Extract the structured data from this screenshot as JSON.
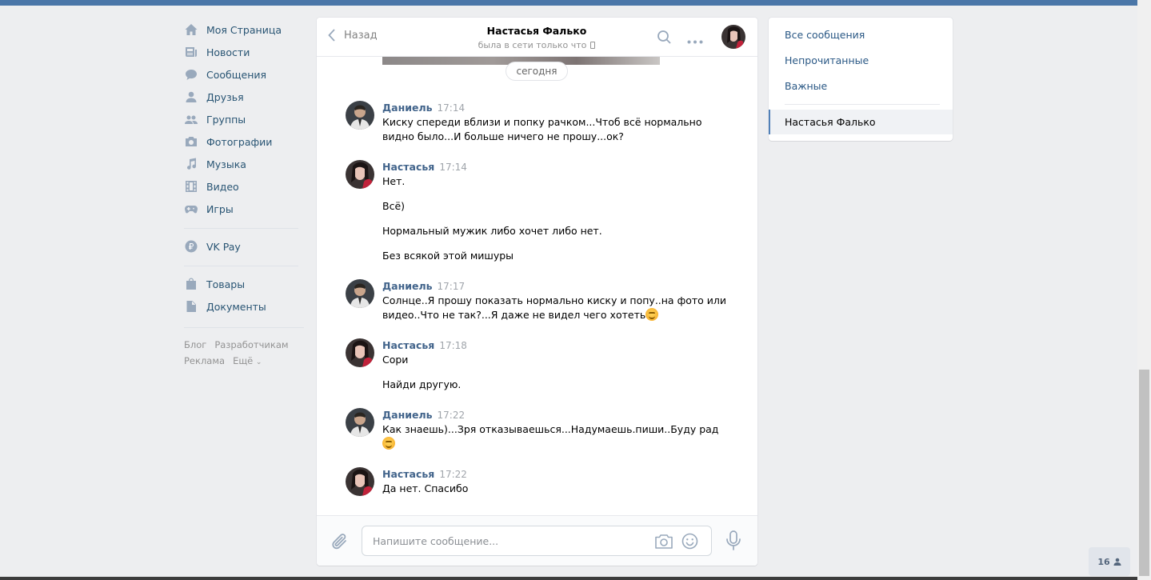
{
  "nav": {
    "items": [
      {
        "label": "Моя Страница",
        "icon": "home-icon"
      },
      {
        "label": "Новости",
        "icon": "news-icon"
      },
      {
        "label": "Сообщения",
        "icon": "messages-icon"
      },
      {
        "label": "Друзья",
        "icon": "friends-icon"
      },
      {
        "label": "Группы",
        "icon": "groups-icon"
      },
      {
        "label": "Фотографии",
        "icon": "camera-icon"
      },
      {
        "label": "Музыка",
        "icon": "music-icon"
      },
      {
        "label": "Видео",
        "icon": "video-icon"
      },
      {
        "label": "Игры",
        "icon": "gamepad-icon"
      }
    ],
    "pay": {
      "label": "VK Pay",
      "icon": "ruble-icon"
    },
    "extra": [
      {
        "label": "Товары",
        "icon": "bag-icon"
      },
      {
        "label": "Документы",
        "icon": "document-icon"
      }
    ],
    "footer": {
      "blog": "Блог",
      "dev": "Разработчикам",
      "ads": "Реклама",
      "more": "Ещё"
    }
  },
  "chat": {
    "back_label": "Назад",
    "title": "Настасья Фалько",
    "status": "была в сети только что",
    "date_separator": "сегодня",
    "messages": [
      {
        "author": "Даниель",
        "time": "17:14",
        "lines": [
          "Киску спереди вблизи и попку рачком...Чтоб всё нормально видно было...И больше ничего не прошу...ок?"
        ]
      },
      {
        "author": "Настасья",
        "time": "17:14",
        "lines": [
          "Нет.",
          "Всё)",
          "Нормальный мужик либо хочет либо нет.",
          "Без всякой этой мишуры"
        ]
      },
      {
        "author": "Даниель",
        "time": "17:17",
        "lines": [
          "Солнце..Я прошу показать нормально киску и попу..на фото или видео..Что не так?...Я даже не видел чего хотеть"
        ]
      },
      {
        "author": "Настасья",
        "time": "17:18",
        "lines": [
          "Сори",
          "Найди другую."
        ]
      },
      {
        "author": "Даниель",
        "time": "17:22",
        "lines": [
          "Как знаешь)...Зря отказываешься...Надумаешь.пиши..Буду рад"
        ]
      },
      {
        "author": "Настасья",
        "time": "17:22",
        "lines": [
          "Да нет. Спасибо"
        ]
      }
    ],
    "composer": {
      "placeholder": "Напишите сообщение..."
    }
  },
  "filters": {
    "all": "Все сообщения",
    "unread": "Непрочитанные",
    "important": "Важные",
    "active_chat": "Настасья Фалько"
  },
  "online_count": "16",
  "colors": {
    "accent": "#4a76a8",
    "link": "#2a5885",
    "author": "#42648b",
    "background": "#edeef0"
  }
}
